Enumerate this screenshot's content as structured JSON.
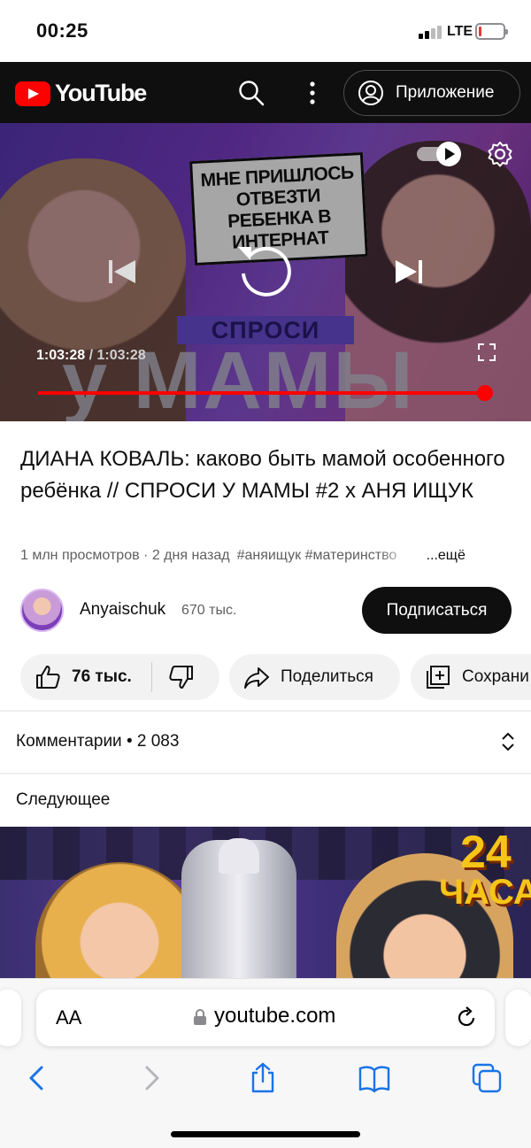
{
  "status_bar": {
    "time": "00:25",
    "network": "LTE",
    "battery_level": 0.1
  },
  "header": {
    "brand": "YouTube",
    "search_icon": "search-icon",
    "more_icon": "more-vert-icon",
    "app_button_label": "Приложение"
  },
  "player": {
    "thumbnail_headline": "МНЕ ПРИШЛОСЬ ОТВЕЗТИ РЕБЕНКА В ИНТЕРНАТ",
    "thumbnail_show_label": "СПРОСИ",
    "thumbnail_show_title": "у МАМЫ",
    "current_time": "1:03:28",
    "time_separator": " / ",
    "duration": "1:03:28",
    "progress": 1.0,
    "colors": {
      "progress": "#ff0000"
    }
  },
  "video": {
    "title": "ДИАНА КОВАЛЬ: каково быть мамой особенного ребёнка // СПРОСИ У МАМЫ #2 x АНЯ ИЩУК",
    "meta": "1 млн просмотров · 2 дня назад",
    "hashtags": "#аняищук #материнство",
    "more_label": "...ещё"
  },
  "channel": {
    "name": "Anyaischuk",
    "subscribers": "670 тыс.",
    "subscribe_label": "Подписаться"
  },
  "actions": {
    "likes": "76 тыс.",
    "share_label": "Поделиться",
    "save_label": "Сохрани"
  },
  "comments": {
    "label": "Комментарии • 2 083"
  },
  "up_next": {
    "label": "Следующее",
    "badge_number": "24",
    "badge_text": "ЧАСА"
  },
  "safari": {
    "text_size_label": "AA",
    "url": "youtube.com"
  }
}
